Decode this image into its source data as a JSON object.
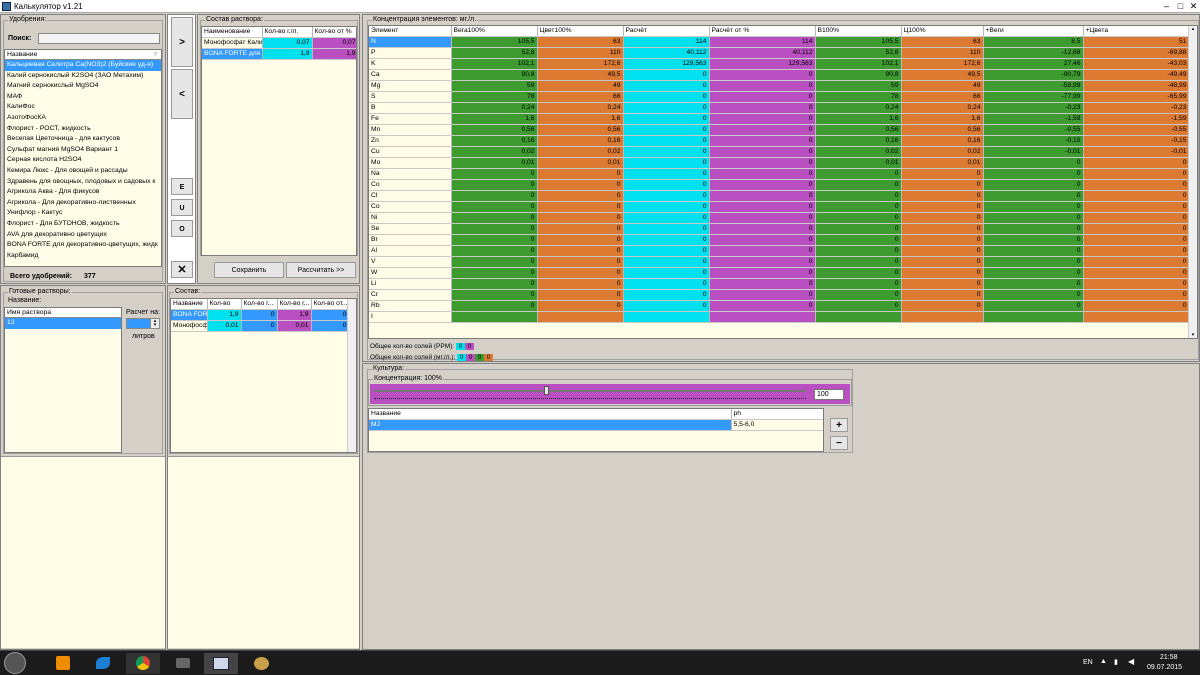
{
  "window": {
    "title": "Калькулятор v1.21"
  },
  "fertilizers": {
    "legend": "Удобрения:",
    "search_label": "Поиск:",
    "search_value": "",
    "column": "Название",
    "items": [
      "Кальциевая Селитра Ca(NO3)2 (Буйские уд-я)",
      "Калий сернокислый K2SO4 (ЗАО Метахим)",
      "Магний сернокислый MgSO4",
      "МАФ",
      "КалиФос",
      "АзотоФосКА",
      "Флорист - РОСТ, жидкость",
      "Веселая Цветочница - для кактусов",
      "Сульфат магния MgSO4 Вариант 1",
      "Серная кислота H2SO4",
      "Кемира Люкс - Для овощей и рассады",
      "Здравень для овощных, плодовых и садовых к",
      "Агрикола Аква - Для фикусов",
      "Агрикола - Для декоративно-лиственных",
      "Унифлор - Кактус",
      "Флорист - Для БУТОНОВ, жидкость",
      "AVA для декоративно цветущих",
      "BONA FORTE для декоративно-цветущих, жидк",
      "Карбамид"
    ],
    "total_label": "Всего удобрений:",
    "total_value": "377"
  },
  "side_buttons": {
    "add": ">",
    "remove": "<",
    "e": "E",
    "u": "U",
    "o": "O",
    "close": "✕"
  },
  "solution": {
    "legend": "Состав раствора:",
    "columns": [
      "Наименование",
      "Кол-во г./л.",
      "Кол-во от %"
    ],
    "rows": [
      {
        "name": "Монофосфат Кали",
        "g": "0,07",
        "p": "0,07"
      },
      {
        "name": "BONA FORTE для",
        "g": "1,9",
        "p": "1,9"
      }
    ],
    "save": "Сохранить",
    "calc": "Рассчитать >>"
  },
  "ready": {
    "legend": "Готовые растворы:",
    "name_label": "Название:",
    "column": "Имя раствора",
    "items": [
      "12"
    ],
    "calc_label": "Расчет на:",
    "liters_label": "литров",
    "liters_value": ""
  },
  "composition": {
    "legend": "Состав:",
    "columns": [
      "Название",
      "Кол-во",
      "Кол-во г...",
      "Кол-во г...",
      "Кол-во от..."
    ],
    "rows": [
      {
        "name": "BONA FOR",
        "a": "1,9",
        "b": "0",
        "c": "1,9",
        "d": "0"
      },
      {
        "name": "Монофосф",
        "a": "0,01",
        "b": "0",
        "c": "0,01",
        "d": "0"
      }
    ]
  },
  "concentration": {
    "legend": "Концентрация элементов: мг./л.",
    "columns": [
      "Элемент",
      "Вега100%",
      "Цвет100%",
      "Расчёт",
      "Расчёт от %",
      "В100%",
      "Ц100%",
      "+Веги",
      "+Цвета"
    ],
    "rows": [
      [
        "N",
        "105,5",
        "63",
        "114",
        "114",
        "105,5",
        "63",
        "8,5",
        "51"
      ],
      [
        "P",
        "52,8",
        "110",
        "40,112",
        "40,112",
        "52,8",
        "110",
        "-12,68",
        "-69,88"
      ],
      [
        "K",
        "102,1",
        "172,6",
        "129,563",
        "129,563",
        "102,1",
        "172,6",
        "27,46",
        "-43,03"
      ],
      [
        "Ca",
        "90,8",
        "49,5",
        "0",
        "0",
        "90,8",
        "49,5",
        "-90,79",
        "-49,49"
      ],
      [
        "Mg",
        "59",
        "49",
        "0",
        "0",
        "59",
        "49",
        "-58,99",
        "-48,99"
      ],
      [
        "S",
        "78",
        "66",
        "0",
        "0",
        "78",
        "66",
        "-77,99",
        "-65,99"
      ],
      [
        "B",
        "0,24",
        "0,24",
        "0",
        "0",
        "0,24",
        "0,24",
        "-0,23",
        "-0,23"
      ],
      [
        "Fe",
        "1,6",
        "1,6",
        "0",
        "0",
        "1,6",
        "1,6",
        "-1,59",
        "-1,59"
      ],
      [
        "Mn",
        "0,56",
        "0,56",
        "0",
        "0",
        "0,56",
        "0,56",
        "-0,55",
        "-0,55"
      ],
      [
        "Zn",
        "0,16",
        "0,16",
        "0",
        "0",
        "0,16",
        "0,16",
        "-0,15",
        "-0,15"
      ],
      [
        "Cu",
        "0,02",
        "0,02",
        "0",
        "0",
        "0,02",
        "0,02",
        "-0,01",
        "-0,01"
      ],
      [
        "Mo",
        "0,01",
        "0,01",
        "0",
        "0",
        "0,01",
        "0,01",
        "0",
        "0"
      ],
      [
        "Na",
        "0",
        "0",
        "0",
        "0",
        "0",
        "0",
        "0",
        "0"
      ],
      [
        "Co",
        "0",
        "0",
        "0",
        "0",
        "0",
        "0",
        "0",
        "0"
      ],
      [
        "Cl",
        "0",
        "0",
        "0",
        "0",
        "0",
        "0",
        "0",
        "0"
      ],
      [
        "Co",
        "0",
        "0",
        "0",
        "0",
        "0",
        "0",
        "0",
        "0"
      ],
      [
        "Ni",
        "0",
        "0",
        "0",
        "0",
        "0",
        "0",
        "0",
        "0"
      ],
      [
        "Se",
        "0",
        "0",
        "0",
        "0",
        "0",
        "0",
        "0",
        "0"
      ],
      [
        "Br",
        "0",
        "0",
        "0",
        "0",
        "0",
        "0",
        "0",
        "0"
      ],
      [
        "Al",
        "0",
        "0",
        "0",
        "0",
        "0",
        "0",
        "0",
        "0"
      ],
      [
        "V",
        "0",
        "0",
        "0",
        "0",
        "0",
        "0",
        "0",
        "0"
      ],
      [
        "W",
        "0",
        "0",
        "0",
        "0",
        "0",
        "0",
        "0",
        "0"
      ],
      [
        "Li",
        "0",
        "0",
        "0",
        "0",
        "0",
        "0",
        "0",
        "0"
      ],
      [
        "Cr",
        "0",
        "0",
        "0",
        "0",
        "0",
        "0",
        "0",
        "0"
      ],
      [
        "Rb",
        "0",
        "0",
        "0",
        "0",
        "0",
        "0",
        "0",
        "0"
      ],
      [
        "I",
        "",
        "",
        "",
        "",
        "",
        "",
        "",
        ""
      ]
    ],
    "colors": [
      "#fffde8",
      "#3d9b2f",
      "#dd7a32",
      "#00e0ef",
      "#b94fc0",
      "#3d9b2f",
      "#dd7a32",
      "#3d9b2f",
      "#dd7a32"
    ],
    "ppm_label": "Общее кол-во солей (PPM):",
    "ppm_values": [
      "0",
      "0"
    ],
    "mg_label": "Общее кол-во солей (мг./л.):",
    "mg_values": [
      "0",
      "0",
      "0",
      "0"
    ]
  },
  "culture": {
    "legend": "Культура:",
    "conc_label": "Концентрация: 100%",
    "slider_value": "100",
    "columns": [
      "Название",
      "ph"
    ],
    "rows": [
      {
        "name": "MJ",
        "ph": "5,5-6,0"
      }
    ],
    "plus": "+",
    "minus": "−"
  },
  "taskbar": {
    "lang": "EN",
    "time": "21:58",
    "date": "09.07.2015"
  }
}
